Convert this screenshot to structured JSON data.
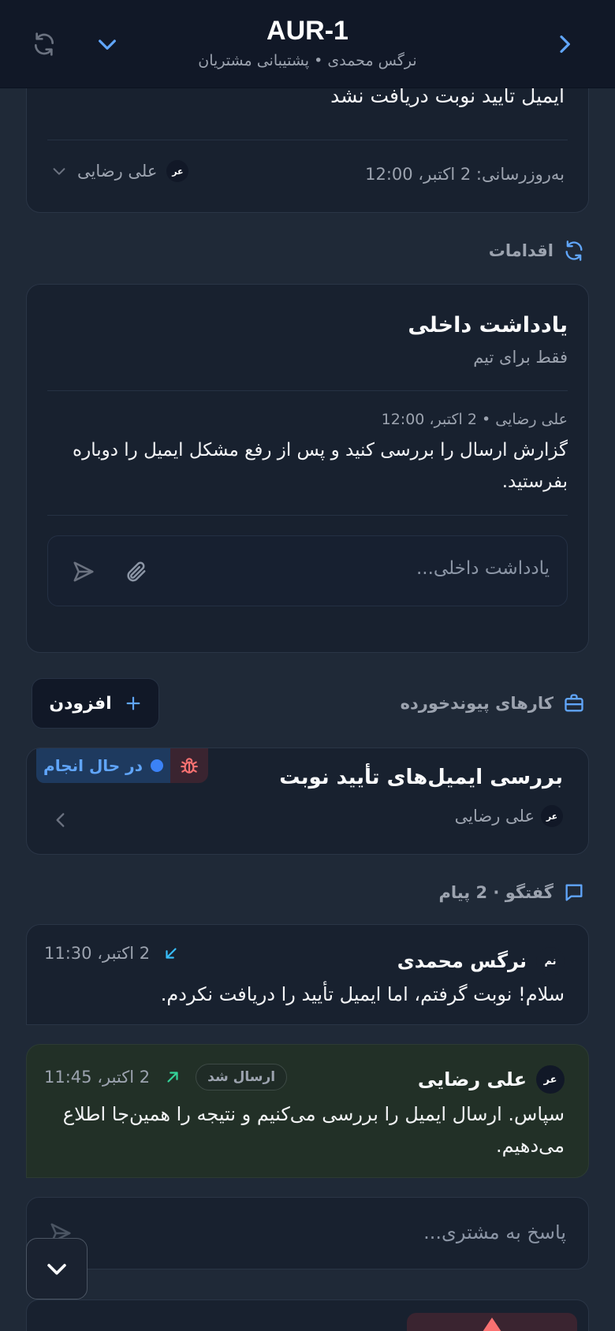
{
  "header": {
    "title": "AUR-1",
    "subtitle": "نرگس محمدی • پشتیبانی مشتریان"
  },
  "ticket_card": {
    "text": "ایمیل تأیید نوبت دریافت نشد",
    "updated": "به‌روزرسانی: 2 اکتبر، 12:00",
    "assignee_initials": "عر",
    "assignee_name": "علی رضایی"
  },
  "actions": {
    "label": "اقدامات"
  },
  "internal_note": {
    "title": "یادداشت داخلی",
    "subtitle": "فقط برای تیم",
    "note_meta": "علی رضایی • 2 اکتبر، 12:00",
    "note_text": "گزارش ارسال را بررسی کنید و پس از رفع مشکل ایمیل را دوباره بفرستید.",
    "input_placeholder": "یادداشت داخلی..."
  },
  "linked_tasks": {
    "label": "کارهای پیوندخورده",
    "add_label": "افزودن",
    "task": {
      "title": "بررسی ایمیل‌های تأیید نوبت",
      "status": "در حال انجام",
      "assignee_initials": "عر",
      "assignee_name": "علی رضایی"
    }
  },
  "conversation": {
    "label": "گفتگو · 2 پیام",
    "messages": [
      {
        "initials": "نم",
        "sender": "نرگس محمدی",
        "time": "2 اکتبر، 11:30",
        "text": "سلام! نوبت گرفتم، اما ایمیل تأیید را دریافت نکردم."
      },
      {
        "initials": "عر",
        "sender": "علی رضایی",
        "badge": "ارسال شد",
        "time": "2 اکتبر، 11:45",
        "text": "سپاس. ارسال ایمیل را بررسی می‌کنیم و نتیجه را همین‌جا اطلاع می‌دهیم."
      }
    ],
    "reply_placeholder": "پاسخ به مشتری..."
  },
  "colors": {
    "background": "#1f2937",
    "card": "#18212f",
    "header": "#111827",
    "accent_blue": "#60a5fa",
    "status_pill": "#1e3a5f",
    "bug_red": "#f87171",
    "outgoing_bubble": "#223027",
    "incoming_arrow": "#38bdf8",
    "outgoing_arrow": "#34d399"
  }
}
